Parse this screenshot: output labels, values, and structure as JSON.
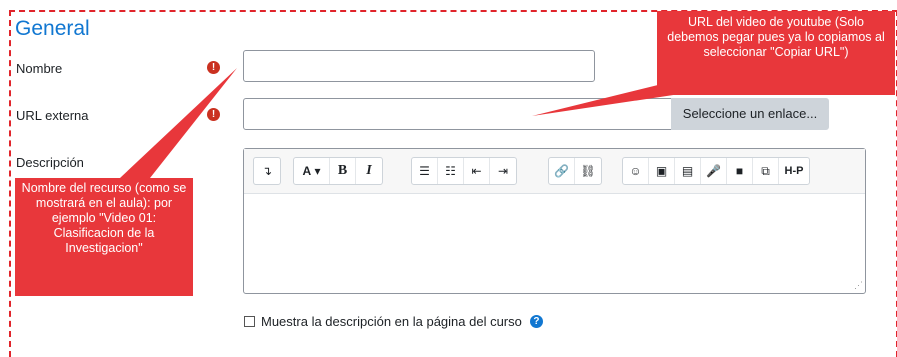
{
  "section": {
    "title": "General"
  },
  "fields": {
    "name": {
      "label": "Nombre",
      "value": "",
      "required_icon": "exclamation-icon"
    },
    "url": {
      "label": "URL externa",
      "value": "",
      "required_icon": "exclamation-icon",
      "button_label": "Seleccione un enlace..."
    },
    "description": {
      "label": "Descripción"
    }
  },
  "editor": {
    "toolbar_groups": [
      [
        "collapse-icon"
      ],
      [
        "font-style-icon",
        "bold-icon",
        "italic-icon"
      ],
      [
        "bullet-list-icon",
        "numbered-list-icon",
        "outdent-icon",
        "indent-icon"
      ],
      [
        "link-icon",
        "unlink-icon"
      ],
      [
        "emoji-icon",
        "image-icon",
        "media-icon",
        "record-audio-icon",
        "record-video-icon",
        "manage-files-icon",
        "h5p-icon"
      ]
    ],
    "font_button_label": "A",
    "bold_label": "B",
    "italic_label": "I",
    "h5p_label": "H-P"
  },
  "checkbox": {
    "label": "Muestra la descripción en la página del curso",
    "checked": false
  },
  "callouts": {
    "url_note": "URL del video de youtube (Solo debemos pegar pues ya lo copiamos al seleccionar \"Copiar URL\")",
    "name_note": "Nombre del recurso (como se mostrará en el aula): por ejemplo \"Video 01: Clasificacion de la Investigacion\""
  },
  "colors": {
    "accent": "#1177d1",
    "annotation": "#e8373b",
    "required": "#ca3120"
  }
}
